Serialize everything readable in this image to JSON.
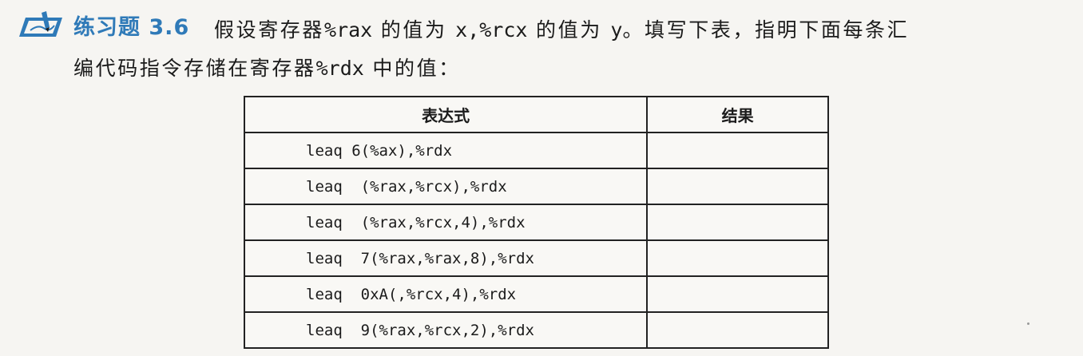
{
  "exercise": {
    "icon": "pencil-writing-icon",
    "label": "练习题 3.6",
    "text_part1": "假设寄存器",
    "reg_rax": "%rax",
    "text_part2": "的值为",
    "var_x": "x,",
    "reg_rcx": "%rcx",
    "text_part3": "的值为",
    "var_y": "y",
    "text_part4": "。填写下表，指明下面每条汇",
    "text_line2a": "编代码指令存储在寄存器",
    "reg_rdx": "%rdx",
    "text_line2b": "中的值：",
    "accent_color": "#2f7ab8"
  },
  "table": {
    "headers": {
      "expression": "表达式",
      "result": "结果"
    },
    "rows": [
      {
        "expression": "leaq 6(%ax),%rdx",
        "result": ""
      },
      {
        "expression": "leaq  (%rax,%rcx),%rdx",
        "result": ""
      },
      {
        "expression": "leaq  (%rax,%rcx,4),%rdx",
        "result": ""
      },
      {
        "expression": "leaq  7(%rax,%rax,8),%rdx",
        "result": ""
      },
      {
        "expression": "leaq  0xA(,%rcx,4),%rdx",
        "result": ""
      },
      {
        "expression": "leaq  9(%rax,%rcx,2),%rdx",
        "result": ""
      }
    ]
  }
}
